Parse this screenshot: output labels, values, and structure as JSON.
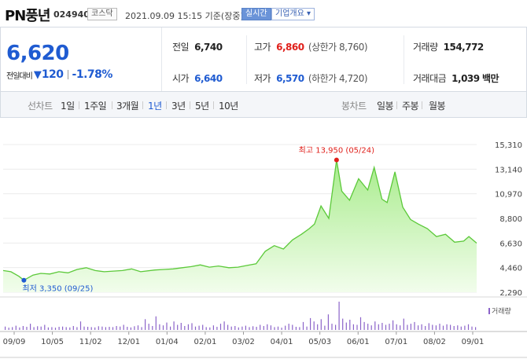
{
  "header": {
    "name": "PN풍년",
    "code": "024940",
    "market": "코스닥",
    "datetime": "2021.09.09 15:15 기준(장중)",
    "realtime": "실시간",
    "company_info": "기업개요"
  },
  "quote": {
    "price": "6,620",
    "change_label": "전일대비",
    "change_value": "120",
    "change_rate": "-1.78%"
  },
  "stats": {
    "prev_close_label": "전일",
    "prev_close": "6,740",
    "high_label": "고가",
    "high": "6,860",
    "upper_limit_label": "상한가",
    "upper_limit": "8,760",
    "volume_label": "거래량",
    "volume": "154,772",
    "open_label": "시가",
    "open": "6,640",
    "low_label": "저가",
    "low": "6,570",
    "lower_limit_label": "하한가",
    "lower_limit": "4,720",
    "trade_value_label": "거래대금",
    "trade_value": "1,039",
    "trade_value_unit": "백만"
  },
  "line_tabs": {
    "label": "선차트",
    "items": [
      "1일",
      "1주일",
      "3개월",
      "1년",
      "3년",
      "5년",
      "10년"
    ],
    "active": "1년"
  },
  "candle_tabs": {
    "label": "봉차트",
    "items": [
      "일봉",
      "주봉",
      "월봉"
    ]
  },
  "chart_data": {
    "type": "area",
    "x_tick_labels": [
      "09/09",
      "10/05",
      "11/02",
      "12/01",
      "01/04",
      "02/01",
      "03/02",
      "04/01",
      "05/03",
      "06/01",
      "07/01",
      "08/02",
      "09/01"
    ],
    "y_tick_labels": [
      "15,310",
      "13,140",
      "10,970",
      "8,800",
      "6,630",
      "4,460",
      "2,290"
    ],
    "ylim": [
      2290,
      15310
    ],
    "series": [
      {
        "x": [
          "2020-09-09",
          "2020-09-15",
          "2020-09-21",
          "2020-09-25",
          "2020-10-02",
          "2020-10-08",
          "2020-10-15",
          "2020-10-22",
          "2020-10-29",
          "2020-11-05",
          "2020-11-12",
          "2020-11-19",
          "2020-11-26",
          "2020-12-03",
          "2020-12-10",
          "2020-12-17",
          "2020-12-24",
          "2021-01-04",
          "2021-01-11",
          "2021-01-18",
          "2021-01-25",
          "2021-02-01",
          "2021-02-08",
          "2021-02-15",
          "2021-02-22",
          "2021-03-02",
          "2021-03-09",
          "2021-03-16",
          "2021-03-23",
          "2021-03-30",
          "2021-04-06",
          "2021-04-13",
          "2021-04-20",
          "2021-04-27",
          "2021-05-03",
          "2021-05-07",
          "2021-05-12",
          "2021-05-18",
          "2021-05-24",
          "2021-05-28",
          "2021-06-03",
          "2021-06-10",
          "2021-06-17",
          "2021-06-22",
          "2021-06-28",
          "2021-07-02",
          "2021-07-08",
          "2021-07-14",
          "2021-07-20",
          "2021-07-26",
          "2021-08-02",
          "2021-08-09",
          "2021-08-16",
          "2021-08-23",
          "2021-08-30",
          "2021-09-03",
          "2021-09-09"
        ],
        "values": [
          4200,
          4100,
          3700,
          3350,
          3800,
          3950,
          3900,
          4100,
          4000,
          4300,
          4450,
          4200,
          4100,
          4150,
          4200,
          4350,
          4100,
          4250,
          4300,
          4350,
          4450,
          4550,
          4700,
          4500,
          4600,
          4450,
          4500,
          4650,
          4800,
          5900,
          6400,
          6100,
          6900,
          7400,
          7900,
          8300,
          9900,
          8800,
          13950,
          11200,
          10400,
          12300,
          11300,
          13300,
          10500,
          10200,
          12900,
          9800,
          8700,
          8300,
          7900,
          7200,
          7400,
          6700,
          6800,
          7200,
          6620
        ]
      }
    ],
    "annotations": [
      {
        "label": "최고 13,950 (05/24)",
        "x": "2021-05-24",
        "y": 13950,
        "color": "#e0201b"
      },
      {
        "label": "최저 3,350 (09/25)",
        "x": "2020-09-25",
        "y": 3350,
        "color": "#1f5bd1"
      }
    ],
    "volume": {
      "name": "거래량",
      "values": [
        12,
        8,
        10,
        15,
        9,
        14,
        11,
        22,
        10,
        13,
        12,
        18,
        9,
        10,
        8,
        11,
        12,
        10,
        9,
        14,
        10,
        30,
        12,
        11,
        10,
        9,
        13,
        12,
        10,
        11,
        10,
        14,
        12,
        18,
        11,
        9,
        13,
        16,
        10,
        38,
        22,
        14,
        48,
        20,
        16,
        26,
        12,
        30,
        18,
        25,
        14,
        20,
        24,
        12,
        15,
        18,
        10,
        9,
        16,
        11,
        22,
        30,
        18,
        12,
        14,
        9,
        12,
        15,
        10,
        13,
        11,
        18,
        14,
        20,
        16,
        10,
        12,
        8,
        15,
        22,
        18,
        11,
        10,
        28,
        12,
        42,
        30,
        20,
        38,
        15,
        55,
        22,
        18,
        100,
        40,
        26,
        36,
        20,
        18,
        45,
        28,
        22,
        16,
        30,
        20,
        25,
        18,
        22,
        34,
        20,
        16,
        40,
        18,
        22,
        28,
        16,
        20,
        14,
        24,
        18,
        16,
        22,
        15,
        20,
        18,
        14,
        16,
        12,
        15,
        20,
        12,
        10
      ]
    },
    "grid": true,
    "legend": "bottom-right"
  }
}
